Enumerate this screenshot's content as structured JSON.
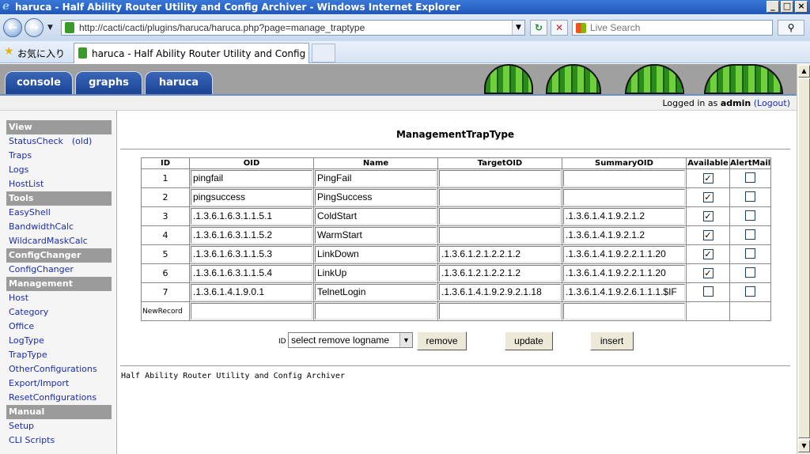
{
  "window": {
    "title": "haruca - Half Ability Router Utility and Config Archiver - Windows Internet Explorer",
    "min_glyph": "_",
    "max_glyph": "□",
    "close_glyph": "×"
  },
  "address_bar": {
    "url": "http://cacti/cacti/plugins/haruca/haruca.php?page=manage_traptype",
    "search_placeholder": "Live Search",
    "back_glyph": "←",
    "forward_glyph": "→",
    "refresh_glyph": "↻",
    "stop_glyph": "✕",
    "search_glyph": "⚲"
  },
  "favorites_bar": {
    "favorites_label": "お気に入り",
    "tab_title": "haruca - Half Ability Router Utility and Config Arc..."
  },
  "cacti_tabs": [
    {
      "label": "console"
    },
    {
      "label": "graphs"
    },
    {
      "label": "haruca"
    }
  ],
  "login": {
    "prefix": "Logged in as",
    "user": "admin",
    "logout": "(Logout)"
  },
  "sidebar": {
    "sections": [
      {
        "title": "View",
        "items": [
          "StatusCheck　(old)",
          "Traps",
          "Logs",
          "HostList"
        ]
      },
      {
        "title": "Tools",
        "items": [
          "EasyShell",
          "BandwidthCalc",
          "WildcardMaskCalc"
        ]
      },
      {
        "title": "ConfigChanger",
        "items": [
          "ConfigChanger"
        ]
      },
      {
        "title": "Management",
        "items": [
          "Host",
          "Category",
          "Office",
          "LogType",
          "TrapType",
          "OtherConfigurations",
          "Export/Import",
          "ResetConfigurations"
        ]
      },
      {
        "title": "Manual",
        "items": [
          "Setup",
          "CLI Scripts"
        ]
      }
    ]
  },
  "page": {
    "title": "ManagementTrapType",
    "footer": "Half Ability Router Utility and Config Archiver"
  },
  "table": {
    "headers": [
      "ID",
      "OID",
      "Name",
      "TargetOID",
      "SummaryOID",
      "Available",
      "AlertMail"
    ],
    "rows": [
      {
        "id": "1",
        "oid": "pingfail",
        "name": "PingFail",
        "target_oid": "",
        "summary_oid": "",
        "available": true,
        "alertmail": false
      },
      {
        "id": "2",
        "oid": "pingsuccess",
        "name": "PingSuccess",
        "target_oid": "",
        "summary_oid": "",
        "available": true,
        "alertmail": false
      },
      {
        "id": "3",
        "oid": ".1.3.6.1.6.3.1.1.5.1",
        "name": "ColdStart",
        "target_oid": "",
        "summary_oid": ".1.3.6.1.4.1.9.2.1.2",
        "available": true,
        "alertmail": false
      },
      {
        "id": "4",
        "oid": ".1.3.6.1.6.3.1.1.5.2",
        "name": "WarmStart",
        "target_oid": "",
        "summary_oid": ".1.3.6.1.4.1.9.2.1.2",
        "available": true,
        "alertmail": false
      },
      {
        "id": "5",
        "oid": ".1.3.6.1.6.3.1.1.5.3",
        "name": "LinkDown",
        "target_oid": ".1.3.6.1.2.1.2.2.1.2",
        "summary_oid": ".1.3.6.1.4.1.9.2.2.1.1.20",
        "available": true,
        "alertmail": false
      },
      {
        "id": "6",
        "oid": ".1.3.6.1.6.3.1.1.5.4",
        "name": "LinkUp",
        "target_oid": ".1.3.6.1.2.1.2.2.1.2",
        "summary_oid": ".1.3.6.1.4.1.9.2.2.1.1.20",
        "available": true,
        "alertmail": false
      },
      {
        "id": "7",
        "oid": ".1.3.6.1.4.1.9.0.1",
        "name": "TelnetLogin",
        "target_oid": ".1.3.6.1.4.1.9.2.9.2.1.18",
        "summary_oid": ".1.3.6.1.4.1.9.2.6.1.1.1.$IF",
        "available": false,
        "alertmail": false
      }
    ],
    "new_record_label": "NewRecord"
  },
  "actions": {
    "id_label": "ID",
    "select_value": "select remove logname",
    "remove_label": "remove",
    "update_label": "update",
    "insert_label": "insert"
  },
  "colors": {
    "title_bar": "#2a62c6",
    "cacti_tab": "#2a54a8",
    "sidebar_header": "#9b9b9b",
    "link": "#1b2db0"
  }
}
